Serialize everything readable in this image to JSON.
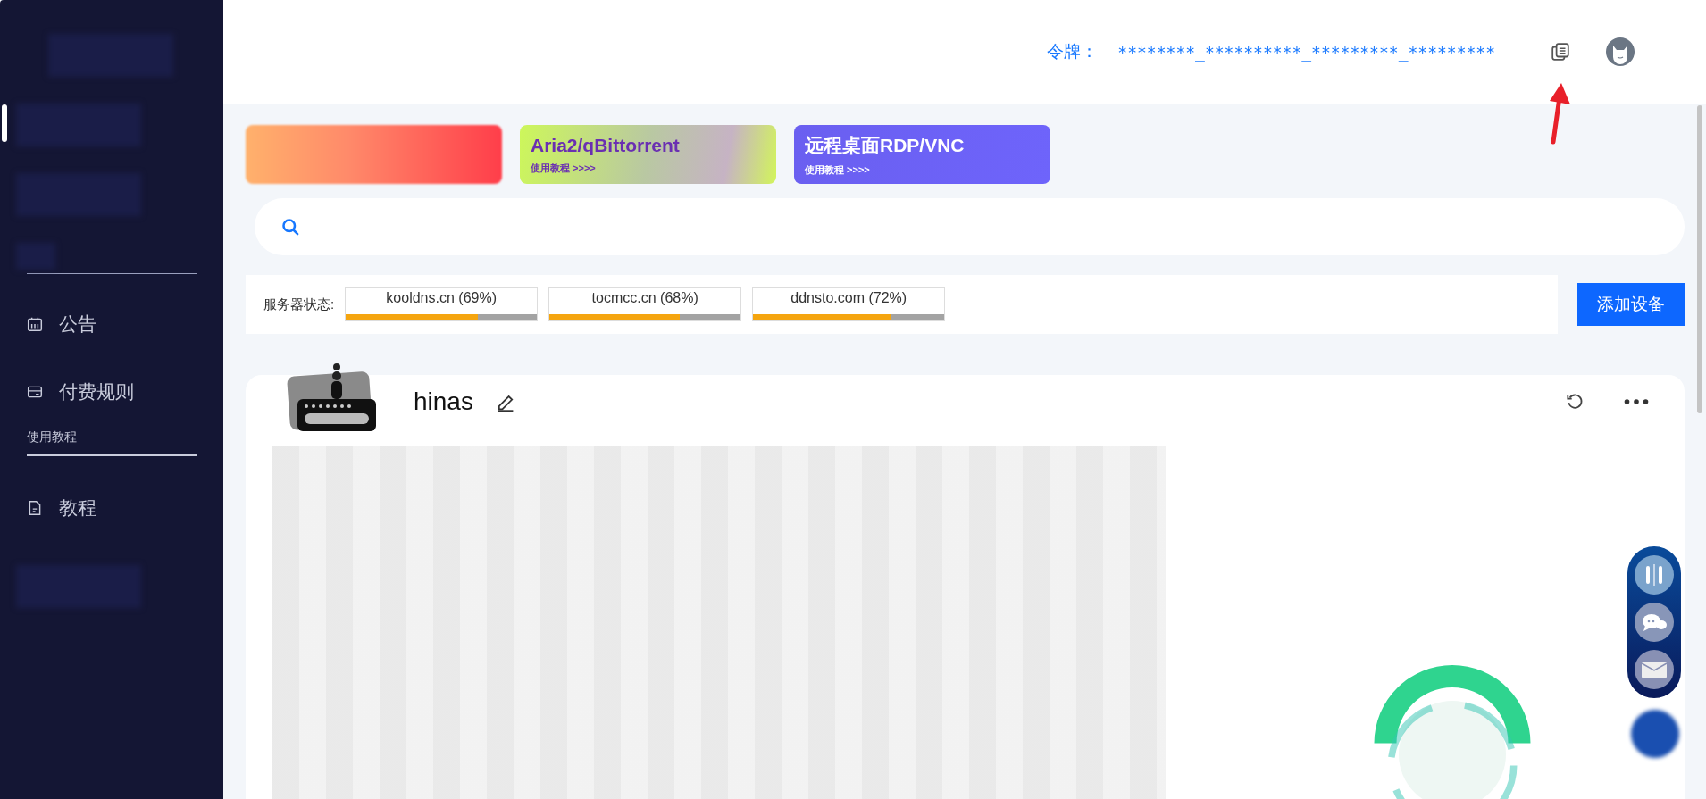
{
  "header": {
    "token_label": "令牌：",
    "token_value": "********_**********_*********_*********"
  },
  "sidebar": {
    "items": [
      {
        "kind": "calendar",
        "label": "公告"
      },
      {
        "kind": "card",
        "label": "付费规则"
      },
      {
        "kind": "heading",
        "label": "使用教程"
      },
      {
        "kind": "doc",
        "label": "教程"
      }
    ]
  },
  "banners": [
    {
      "kind": "blurred"
    },
    {
      "kind": "green",
      "title": "Aria2/qBittorrent",
      "subtitle": "使用教程 >>>>"
    },
    {
      "kind": "purple",
      "title": "远程桌面RDP/VNC",
      "subtitle": "使用教程 >>>>"
    }
  ],
  "server_status": {
    "label": "服务器状态:",
    "servers": [
      {
        "name": "kooldns.cn (69%)",
        "level": 0.69
      },
      {
        "name": "tocmcc.cn (68%)",
        "level": 0.68
      },
      {
        "name": "ddnsto.com (72%)",
        "level": 0.72
      }
    ]
  },
  "add_device_button": "添加设备",
  "device": {
    "name": "hinas"
  }
}
